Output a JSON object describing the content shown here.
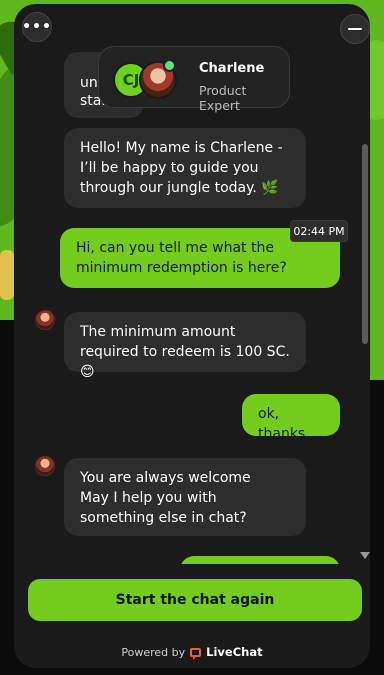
{
  "chat": {
    "header": {
      "agent_name": "Charlene",
      "agent_role": "Product Expert",
      "logo_text": "CJ"
    },
    "messages": [
      {
        "from": "agent",
        "text_line1": "unt",
        "text_line2": "starti"
      },
      {
        "from": "agent",
        "text": "Hello! My name is Charlene - I’ll be happy to guide you through our jungle today. 🌿"
      },
      {
        "from": "user",
        "text": "Hi, can you tell me what the minimum redemption is here?",
        "time": "02:44 PM"
      },
      {
        "from": "agent",
        "text": "The minimum amount required to redeem is 100 SC.😊"
      },
      {
        "from": "user",
        "text": "ok, thanks"
      },
      {
        "from": "agent",
        "text_line1": "You are always welcome",
        "text_line2": "May I help you with something else in chat?"
      }
    ],
    "start_again_label": "Start the chat again",
    "footer": {
      "powered_by": "Powered by",
      "brand": "LiveChat"
    }
  },
  "colors": {
    "accent": "#74cc1c",
    "panel": "#1a1a1a",
    "bubble_agent": "#2d2d2d",
    "online": "#5fe27c",
    "brand_icon": "#ff5a1f"
  },
  "icons": [
    "menu-dots-icon",
    "minimize-icon",
    "online-status-icon",
    "livechat-logo-icon",
    "scroll-down-arrow-icon"
  ]
}
